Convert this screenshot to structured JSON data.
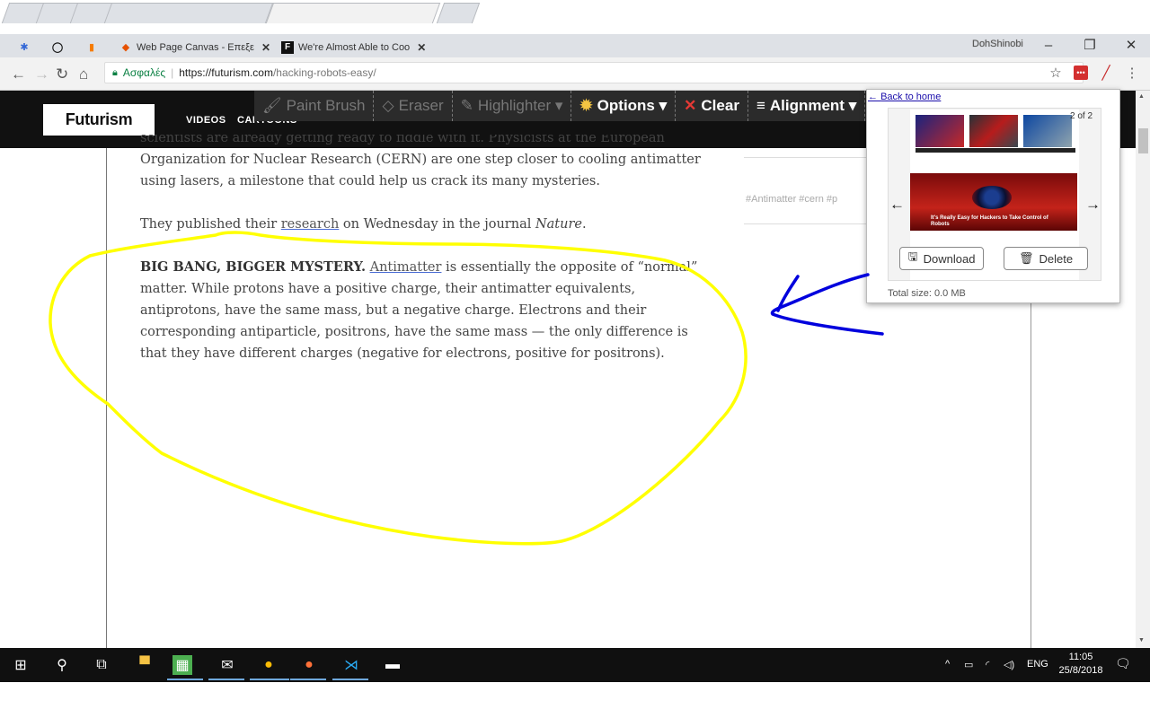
{
  "browser": {
    "tabs": [
      {
        "label": "",
        "icon": "puzzle-icon"
      },
      {
        "label": "",
        "icon": "github-icon"
      },
      {
        "label": "",
        "icon": "analytics-icon"
      },
      {
        "label": "Web Page Canvas - Επεξε",
        "icon": "paint-icon"
      },
      {
        "label": "We're Almost Able to Coo",
        "icon": "futurism-icon"
      }
    ],
    "window_user": "DohShinobi",
    "secure_label": "Ασφαλές",
    "url_host": "https://futurism.com",
    "url_path": "/hacking-robots-easy/"
  },
  "site": {
    "logo": "Futurism",
    "nav": [
      "VIDEOS",
      "CARTOONS"
    ]
  },
  "drawing_toolbar": {
    "tools": [
      "Paint Brush",
      "Eraser",
      "Highlighter ▾",
      "Options ▾",
      "Clear",
      "Alignment ▾"
    ]
  },
  "article": {
    "line_partial": "scientists are already getting ready to fiddle with it. Physicists at the European",
    "para1_rest": "Organization for Nuclear Research (CERN) are one step closer to cooling antimatter using lasers, a milestone that could help us crack its many mysteries.",
    "para2_a": "They published their ",
    "para2_link": "research",
    "para2_b": " on Wednesday in the journal ",
    "para2_journal": "Nature",
    "para2_end": ".",
    "para3_heading": "BIG BANG, BIGGER MYSTERY.",
    "para3_link": "Antimatter",
    "para3_body": " is essentially the opposite of “normal” matter. While protons have a positive charge, their antimatter equivalents, antiprotons, have the same mass, but a negative charge. Electrons and their corresponding antiparticle, positrons, have the same mass — the only difference is that they have different charges (negative for electrons, positive for positrons).",
    "tags": "#Antimatter  #cern  #p"
  },
  "popup": {
    "back_link": "Back to home",
    "counter": "2 of 2",
    "thumb_headline": "It's Really Easy for Hackers to Take Control of Robots",
    "download_label": "Download",
    "delete_label": "Delete",
    "total_size": "Total size: 0.0 MB"
  },
  "taskbar": {
    "language": "ENG",
    "time": "11:05",
    "date": "25/8/2018"
  },
  "colors": {
    "annotation_yellow": "#ffff00",
    "annotation_blue": "#0000dd",
    "header_bg": "#111111"
  }
}
